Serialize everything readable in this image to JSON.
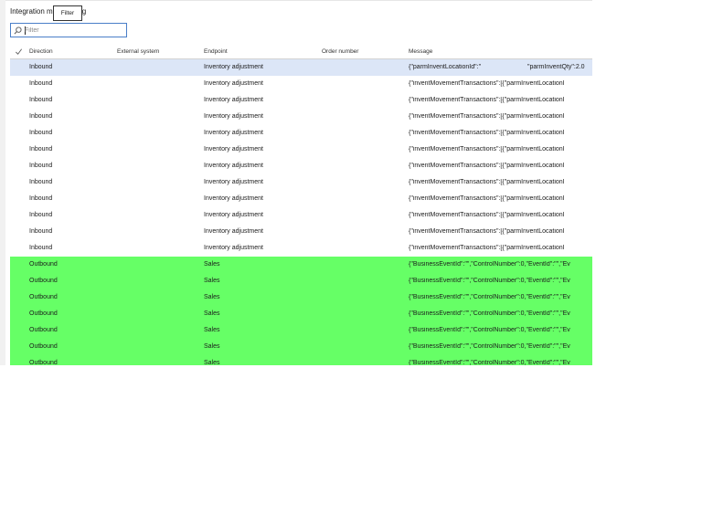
{
  "page": {
    "title": "Integration m",
    "title_tail": "g"
  },
  "tooltip": {
    "text": "Filter"
  },
  "filter": {
    "placeholder": "Filter"
  },
  "columns": {
    "direction": "Direction",
    "external_system": "External system",
    "endpoint": "Endpoint",
    "order_number": "Order number",
    "message": "Message"
  },
  "rows": [
    {
      "direction": "Inbound",
      "endpoint": "Inventory adjustment",
      "message": "{\"parmInventLocationId\":\"",
      "message_extra": "\"parmInventQty\":2.0",
      "state": "selected"
    },
    {
      "direction": "Inbound",
      "endpoint": "Inventory adjustment",
      "message": "{\"inventMovementTransactions\":[{\"parmInventLocationI"
    },
    {
      "direction": "Inbound",
      "endpoint": "Inventory adjustment",
      "message": "{\"inventMovementTransactions\":[{\"parmInventLocationI"
    },
    {
      "direction": "Inbound",
      "endpoint": "Inventory adjustment",
      "message": "{\"inventMovementTransactions\":[{\"parmInventLocationI"
    },
    {
      "direction": "Inbound",
      "endpoint": "Inventory adjustment",
      "message": "{\"inventMovementTransactions\":[{\"parmInventLocationI"
    },
    {
      "direction": "Inbound",
      "endpoint": "Inventory adjustment",
      "message": "{\"inventMovementTransactions\":[{\"parmInventLocationI"
    },
    {
      "direction": "Inbound",
      "endpoint": "Inventory adjustment",
      "message": "{\"inventMovementTransactions\":[{\"parmInventLocationI"
    },
    {
      "direction": "Inbound",
      "endpoint": "Inventory adjustment",
      "message": "{\"inventMovementTransactions\":[{\"parmInventLocationI"
    },
    {
      "direction": "Inbound",
      "endpoint": "Inventory adjustment",
      "message": "{\"inventMovementTransactions\":[{\"parmInventLocationI"
    },
    {
      "direction": "Inbound",
      "endpoint": "Inventory adjustment",
      "message": "{\"inventMovementTransactions\":[{\"parmInventLocationI"
    },
    {
      "direction": "Inbound",
      "endpoint": "Inventory adjustment",
      "message": "{\"inventMovementTransactions\":[{\"parmInventLocationI"
    },
    {
      "direction": "Inbound",
      "endpoint": "Inventory adjustment",
      "message": "{\"inventMovementTransactions\":[{\"parmInventLocationI"
    },
    {
      "direction": "Outbound",
      "endpoint": "Sales",
      "message": "{\"BusinessEventId\":\"\",\"ControlNumber\":0,\"EventId\":\"\",\"Ev",
      "state": "outbound"
    },
    {
      "direction": "Outbound",
      "endpoint": "Sales",
      "message": "{\"BusinessEventId\":\"\",\"ControlNumber\":0,\"EventId\":\"\",\"Ev",
      "state": "outbound"
    },
    {
      "direction": "Outbound",
      "endpoint": "Sales",
      "message": "{\"BusinessEventId\":\"\",\"ControlNumber\":0,\"EventId\":\"\",\"Ev",
      "state": "outbound"
    },
    {
      "direction": "Outbound",
      "endpoint": "Sales",
      "message": "{\"BusinessEventId\":\"\",\"ControlNumber\":0,\"EventId\":\"\",\"Ev",
      "state": "outbound"
    },
    {
      "direction": "Outbound",
      "endpoint": "Sales",
      "message": "{\"BusinessEventId\":\"\",\"ControlNumber\":0,\"EventId\":\"\",\"Ev",
      "state": "outbound"
    },
    {
      "direction": "Outbound",
      "endpoint": "Sales",
      "message": "{\"BusinessEventId\":\"\",\"ControlNumber\":0,\"EventId\":\"\",\"Ev",
      "state": "outbound"
    },
    {
      "direction": "Outbound",
      "endpoint": "Sales",
      "message": "{\"BusinessEventId\":\"\",\"ControlNumber\":0,\"EventId\":\"\",\"Ev",
      "state": "outbound"
    }
  ],
  "colors": {
    "selected": "#dce6f7",
    "outbound": "#66ff66",
    "accent": "#4a7fc8"
  },
  "icons": {
    "search": "search-icon",
    "select_all": "checkmark-icon"
  }
}
